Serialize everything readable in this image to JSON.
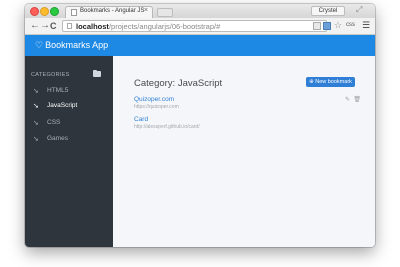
{
  "browser": {
    "tab_title": "Bookmarks - Angular JS",
    "tab_close": "×",
    "user": "Crystel",
    "url_host": "localhost",
    "url_path": "/projects/angularjs/06-bootstrap/#",
    "back_glyph": "←",
    "forward_glyph": "→",
    "reload_glyph": "C",
    "star_glyph": "☆",
    "css_ext_label": "css",
    "menu_glyph": "☰",
    "fullscreen_glyph": "⤢"
  },
  "app": {
    "brand": "Bookmarks App",
    "brand_icon": "heart-icon",
    "accent_color": "#1e88e5"
  },
  "sidebar": {
    "header": "CATEGORIES",
    "items": [
      {
        "label": "HTML5",
        "active": false
      },
      {
        "label": "JavaScript",
        "active": true
      },
      {
        "label": "CSS",
        "active": false
      },
      {
        "label": "Games",
        "active": false
      }
    ]
  },
  "main": {
    "title": "Category: JavaScript",
    "new_button": "New bookmark",
    "bookmarks": [
      {
        "title": "Quizoper.com",
        "url": "https://quizoper.com"
      },
      {
        "title": "Card",
        "url": "http://alessperf.github.io/card/"
      }
    ]
  }
}
